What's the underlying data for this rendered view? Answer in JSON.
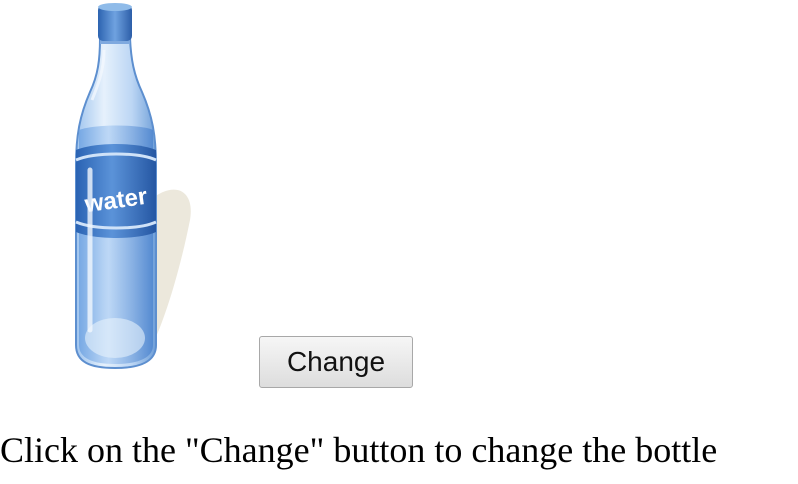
{
  "image": {
    "icon": "water-bottle-icon",
    "label": "water",
    "colors": {
      "cap": "#3a78c8",
      "body": "#c8dff6",
      "water": "#7fb0e8",
      "label_band": "#3572c2",
      "shadow": "#e9e4d6"
    }
  },
  "button": {
    "label": "Change"
  },
  "instruction": {
    "text": "Click on the \"Change\" button to change the bottle"
  }
}
